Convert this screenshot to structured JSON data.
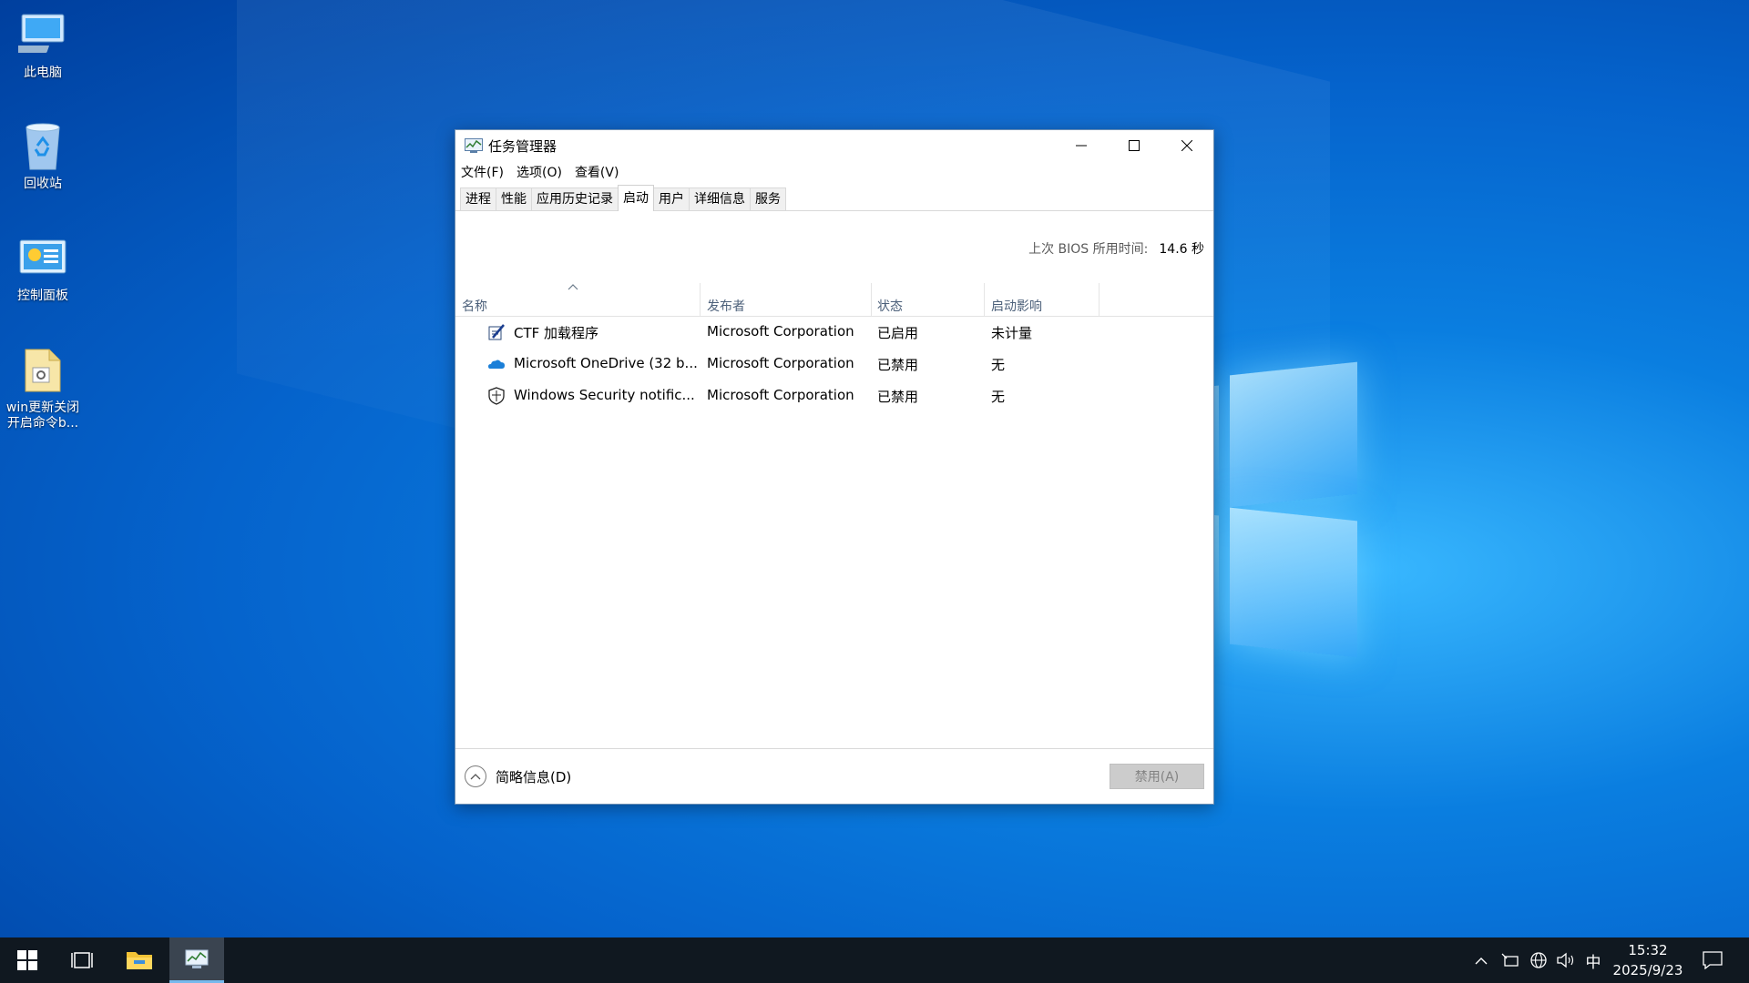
{
  "desktop": {
    "icons": [
      {
        "label": "此电脑",
        "icon": "computer-icon"
      },
      {
        "label": "回收站",
        "icon": "recycle-bin-icon"
      },
      {
        "label": "控制面板",
        "icon": "control-panel-icon"
      },
      {
        "label": "win更新关闭开启命令b...",
        "icon": "folder-file-icon"
      }
    ]
  },
  "window": {
    "title": "任务管理器",
    "menu": [
      "文件(F)",
      "选项(O)",
      "查看(V)"
    ],
    "tabs": [
      "进程",
      "性能",
      "应用历史记录",
      "启动",
      "用户",
      "详细信息",
      "服务"
    ],
    "active_tab": "启动",
    "bios_label": "上次 BIOS 所用时间:",
    "bios_value": "14.6 秒",
    "columns": [
      "名称",
      "发布者",
      "状态",
      "启动影响"
    ],
    "rows": [
      {
        "name": "CTF 加载程序",
        "publisher": "Microsoft Corporation",
        "status": "已启用",
        "impact": "未计量",
        "icon": "ctf-loader-icon"
      },
      {
        "name": "Microsoft OneDrive (32 b...",
        "publisher": "Microsoft Corporation",
        "status": "已禁用",
        "impact": "无",
        "icon": "onedrive-cloud-icon"
      },
      {
        "name": "Windows Security notific...",
        "publisher": "Microsoft Corporation",
        "status": "已禁用",
        "impact": "无",
        "icon": "shield-icon"
      }
    ],
    "fewer_details": "简略信息(D)",
    "disable_button": "禁用(A)"
  },
  "taskbar": {
    "time": "15:32",
    "date": "2025/9/23",
    "ime": "中"
  }
}
